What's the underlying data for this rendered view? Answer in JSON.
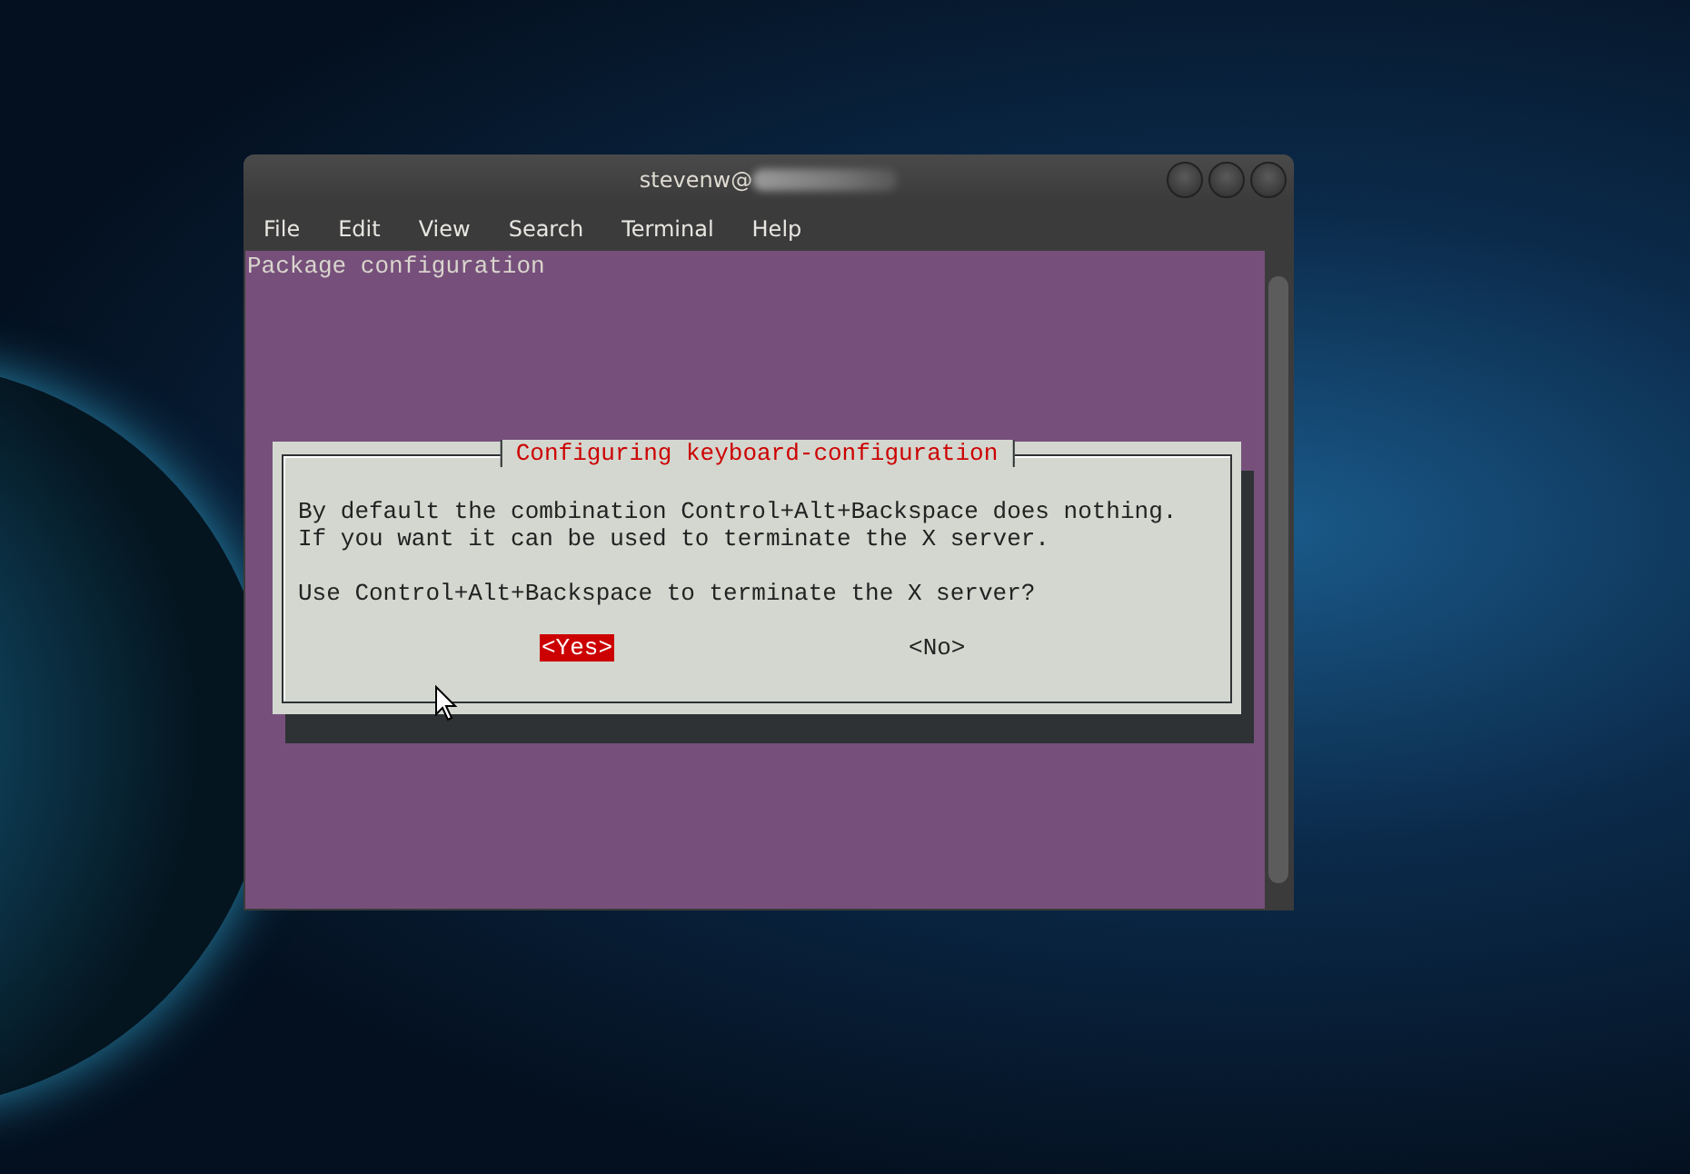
{
  "window": {
    "title": "stevenw@"
  },
  "menu": [
    {
      "label": "File"
    },
    {
      "label": "Edit"
    },
    {
      "label": "View"
    },
    {
      "label": "Search"
    },
    {
      "label": "Terminal"
    },
    {
      "label": "Help"
    }
  ],
  "terminal": {
    "header": "Package configuration"
  },
  "dialog": {
    "title": "Configuring keyboard-configuration",
    "message": "By default the combination Control+Alt+Backspace does nothing.  If you want it can be used to terminate the X server.",
    "question": "Use Control+Alt+Backspace to terminate the X server?",
    "buttons": [
      {
        "label": "<Yes>",
        "selected": true
      },
      {
        "label": "<No>",
        "selected": false
      }
    ]
  }
}
